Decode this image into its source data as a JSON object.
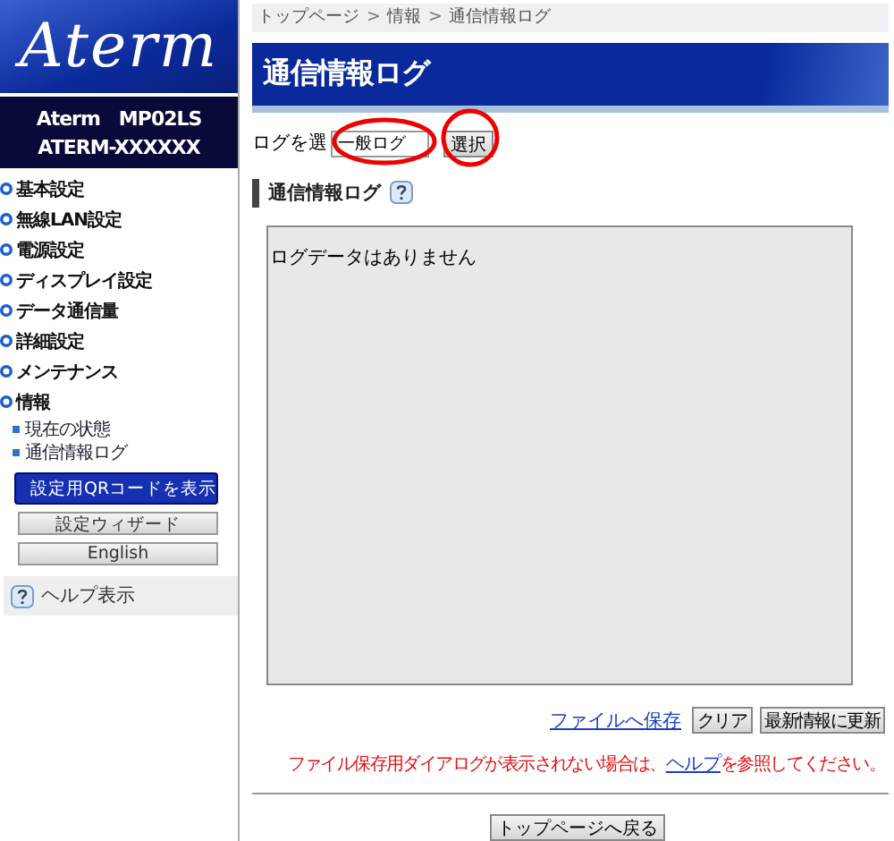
{
  "sidebar": {
    "logo": "Aterm",
    "model": "Aterm　MP02LS",
    "device_name": "ATERM-XXXXXX",
    "menu": [
      {
        "label": "基本設定"
      },
      {
        "label": "無線LAN設定"
      },
      {
        "label": "電源設定"
      },
      {
        "label": "ディスプレイ設定"
      },
      {
        "label": "データ通信量"
      },
      {
        "label": "詳細設定"
      },
      {
        "label": "メンテナンス"
      },
      {
        "label": "情報",
        "children": [
          {
            "label": "現在の状態"
          },
          {
            "label": "通信情報ログ"
          }
        ]
      }
    ],
    "qr_button": "設定用QRコードを表示",
    "wizard_button": "設定ウィザード",
    "language_button": "English",
    "help_toggle": "ヘルプ表示"
  },
  "breadcrumb": [
    "トップページ",
    "情報",
    "通信情報ログ"
  ],
  "breadcrumb_separator": ">",
  "page_title": "通信情報ログ",
  "log_select": {
    "label": "ログを選",
    "value": "一般ログ",
    "button": "選択"
  },
  "section_title": "通信情報ログ",
  "log_text": "ログデータはありません",
  "actions": {
    "save_link": "ファイルへ保存",
    "clear_button": "クリア",
    "refresh_button": "最新情報に更新"
  },
  "notice": {
    "before": "ファイル保存用ダイアログが表示されない場合は、",
    "link": "ヘルプ",
    "after": "を参照してください。"
  },
  "back_button": "トップページへ戻る"
}
